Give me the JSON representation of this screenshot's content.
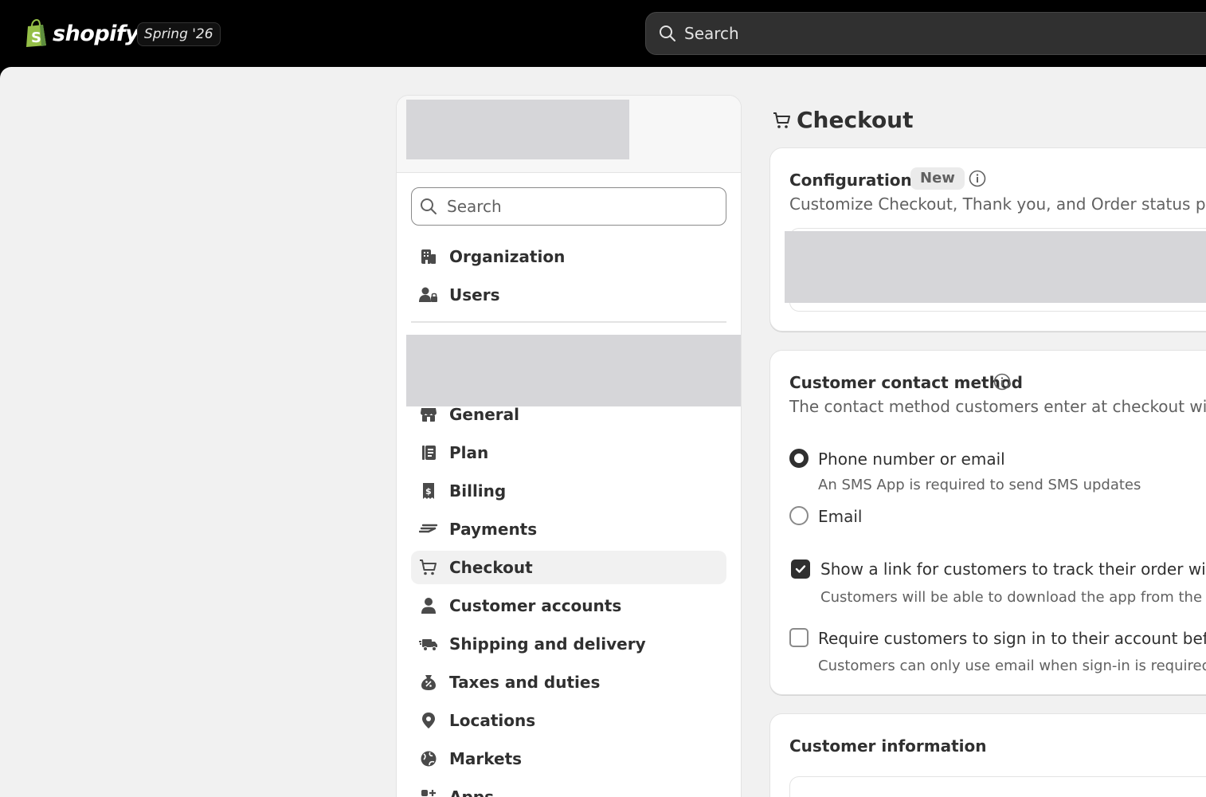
{
  "topbar": {
    "brand": "shopify",
    "edition": "Spring '26",
    "search_placeholder": "Search"
  },
  "nav": {
    "search_placeholder": "Search",
    "org_items": [
      {
        "label": "Organization",
        "icon": "building-icon"
      },
      {
        "label": "Users",
        "icon": "users-icon"
      }
    ],
    "store_items": [
      {
        "label": "General",
        "icon": "store-icon"
      },
      {
        "label": "Plan",
        "icon": "plan-icon"
      },
      {
        "label": "Billing",
        "icon": "billing-icon"
      },
      {
        "label": "Payments",
        "icon": "payments-icon"
      },
      {
        "label": "Checkout",
        "icon": "cart-icon",
        "active": true
      },
      {
        "label": "Customer accounts",
        "icon": "person-icon"
      },
      {
        "label": "Shipping and delivery",
        "icon": "truck-icon"
      },
      {
        "label": "Taxes and duties",
        "icon": "tax-icon"
      },
      {
        "label": "Locations",
        "icon": "location-icon"
      },
      {
        "label": "Markets",
        "icon": "globe-icon"
      },
      {
        "label": "Apps",
        "icon": "apps-icon"
      }
    ]
  },
  "page": {
    "title": "Checkout"
  },
  "configurations": {
    "title": "Configurations",
    "badge": "New",
    "subtitle": "Customize Checkout, Thank you, and Order status pages"
  },
  "contact": {
    "title": "Customer contact method",
    "subtitle": "The contact method customers enter at checkout will rec",
    "options": [
      {
        "label": "Phone number or email",
        "help": "An SMS App is required to send SMS updates",
        "selected": true
      },
      {
        "label": "Email",
        "help": "",
        "selected": false
      }
    ],
    "track_link": {
      "label_before": "Show a link for customers to track their order with ",
      "link_text": "Sh",
      "help": "Customers will be able to download the app from the ord",
      "checked": true
    },
    "require_signin": {
      "label": "Require customers to sign in to their account before c",
      "help": "Customers can only use email when sign-in is required",
      "checked": false
    }
  },
  "customer_info": {
    "title": "Customer information"
  },
  "colors": {
    "topbar": "#000000",
    "canvas": "#f1f1f1",
    "text": "#303030",
    "muted": "#616161",
    "placeholder": "#d6d6d9"
  }
}
